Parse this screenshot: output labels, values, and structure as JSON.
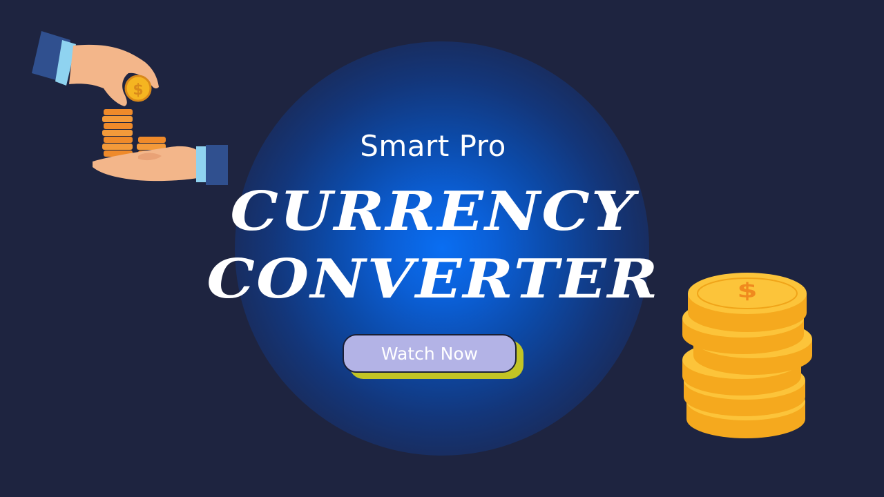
{
  "subtitle": "Smart Pro",
  "headline": {
    "line1": "CURRENCY",
    "line2": "CONVERTER"
  },
  "cta": {
    "label": "Watch Now"
  },
  "coin_symbol": "$",
  "colors": {
    "background": "#1e2440",
    "glow": "#0a6ef2",
    "cta_fill": "#b3b3e6",
    "cta_shadow": "#c2c425",
    "coin_gold": "#f5b521",
    "coin_orange": "#ef8a2a"
  }
}
